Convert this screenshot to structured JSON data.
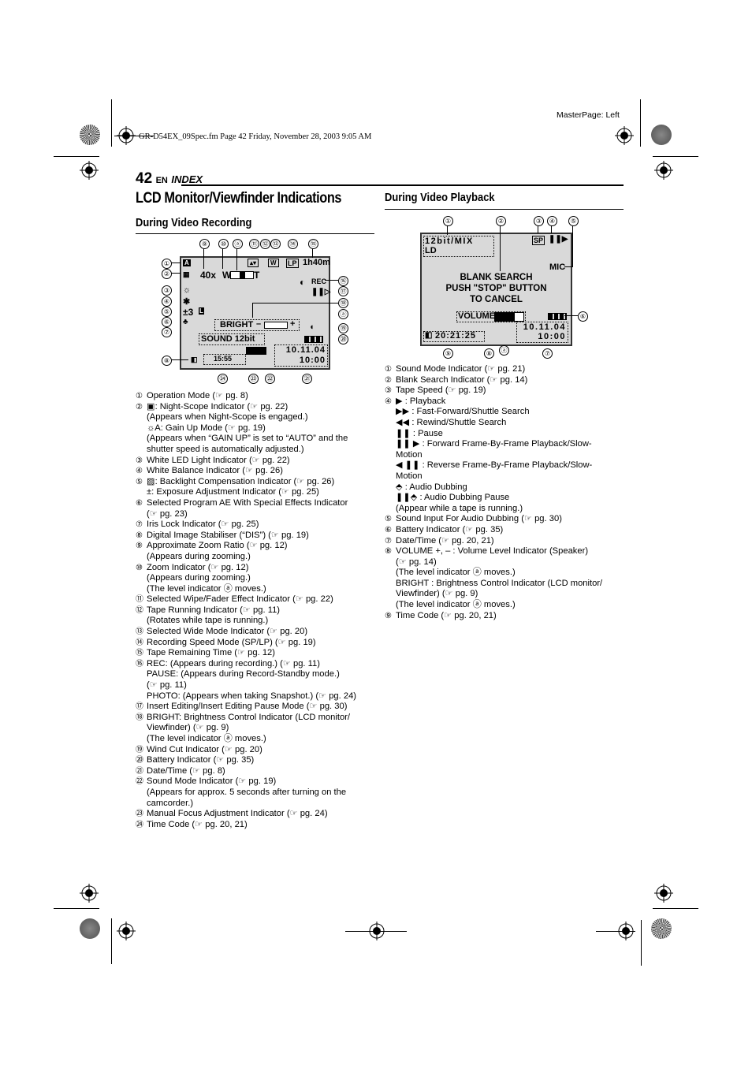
{
  "header": {
    "file_info": "GR-D54EX_09Spec.fm  Page 42  Friday, November 28, 2003  9:05 AM",
    "master_page": "MasterPage: Left",
    "page_number": "42",
    "lang": "EN",
    "section": "INDEX"
  },
  "title": "LCD Monitor/Viewfinder Indications",
  "recording": {
    "heading": "During Video Recording",
    "screen": {
      "zoom_ratio": "40x",
      "zoom_w": "W",
      "zoom_t": "T",
      "tape_speed": "LP",
      "tape_remaining": "1h40m",
      "rec": "REC",
      "exposure": "±3",
      "bright_label": "BRIGHT",
      "bright_minus": "–",
      "bright_plus": "+",
      "sound": "SOUND  12bit",
      "date": "10.11.04",
      "time": "10:00",
      "timecode": "15:55"
    },
    "callouts": [
      "⑨",
      "⑩",
      "ⓐ",
      "⑪",
      "⑫",
      "⑬",
      "⑭",
      "⑮",
      "①",
      "②",
      "③",
      "④",
      "⑤",
      "⑥",
      "⑦",
      "⑧",
      "⑯",
      "⑰",
      "⑱",
      "ⓐ",
      "⑲",
      "⑳",
      "㉔",
      "㉓",
      "㉒",
      "㉑"
    ],
    "items": [
      {
        "num": "①",
        "lines": [
          "Operation Mode (☞ pg. 8)"
        ]
      },
      {
        "num": "②",
        "lines": [
          "▣: Night-Scope Indicator (☞ pg. 22)",
          "(Appears when Night-Scope is engaged.)",
          "☼A: Gain Up Mode (☞ pg. 19)",
          "(Appears when “GAIN UP” is set to “AUTO” and the",
          "shutter speed is automatically adjusted.)"
        ]
      },
      {
        "num": "③",
        "lines": [
          "White LED Light Indicator (☞ pg. 22)"
        ]
      },
      {
        "num": "④",
        "lines": [
          "White Balance Indicator (☞ pg. 26)"
        ]
      },
      {
        "num": "⑤",
        "lines": [
          "▨: Backlight Compensation Indicator (☞ pg. 26)",
          "±: Exposure Adjustment Indicator (☞ pg. 25)"
        ]
      },
      {
        "num": "⑥",
        "lines": [
          "Selected Program AE With Special Effects Indicator",
          "(☞ pg. 23)"
        ]
      },
      {
        "num": "⑦",
        "lines": [
          "Iris Lock Indicator (☞ pg. 25)"
        ]
      },
      {
        "num": "⑧",
        "lines": [
          "Digital Image Stabiliser (“DIS”) (☞ pg. 19)"
        ]
      },
      {
        "num": "⑨",
        "lines": [
          "Approximate Zoom Ratio (☞ pg. 12)",
          "(Appears during zooming.)"
        ]
      },
      {
        "num": "⑩",
        "lines": [
          "Zoom Indicator (☞ pg. 12)",
          "(Appears during zooming.)",
          "(The level indicator ⓐ moves.)"
        ]
      },
      {
        "num": "⑪",
        "lines": [
          "Selected Wipe/Fader Effect Indicator (☞ pg. 22)"
        ]
      },
      {
        "num": "⑫",
        "lines": [
          "Tape Running Indicator (☞ pg. 11)",
          "(Rotates while tape is running.)"
        ]
      },
      {
        "num": "⑬",
        "lines": [
          "Selected Wide Mode Indicator (☞ pg. 20)"
        ]
      },
      {
        "num": "⑭",
        "lines": [
          "Recording Speed Mode (SP/LP) (☞ pg. 19)"
        ]
      },
      {
        "num": "⑮",
        "lines": [
          "Tape Remaining Time (☞ pg. 12)"
        ]
      },
      {
        "num": "⑯",
        "lines": [
          "REC: (Appears during recording.) (☞ pg. 11)",
          "PAUSE: (Appears during Record-Standby mode.)",
          "(☞ pg. 11)",
          "PHOTO: (Appears when taking Snapshot.) (☞ pg. 24)"
        ]
      },
      {
        "num": "⑰",
        "lines": [
          "Insert Editing/Insert Editing Pause Mode (☞ pg. 30)"
        ]
      },
      {
        "num": "⑱",
        "lines": [
          "BRIGHT: Brightness Control Indicator (LCD monitor/",
          "Viewfinder) (☞ pg. 9)",
          "(The level indicator ⓐ moves.)"
        ]
      },
      {
        "num": "⑲",
        "lines": [
          "Wind Cut Indicator (☞ pg. 20)"
        ]
      },
      {
        "num": "⑳",
        "lines": [
          "Battery Indicator (☞ pg. 35)"
        ]
      },
      {
        "num": "㉑",
        "lines": [
          "Date/Time (☞ pg. 8)"
        ]
      },
      {
        "num": "㉒",
        "lines": [
          "Sound Mode Indicator (☞ pg. 19)",
          "(Appears for approx. 5 seconds after turning on the",
          "camcorder.)"
        ]
      },
      {
        "num": "㉓",
        "lines": [
          "Manual Focus Adjustment Indicator (☞ pg. 24)"
        ]
      },
      {
        "num": "㉔",
        "lines": [
          "Time Code (☞ pg. 20, 21)"
        ]
      }
    ]
  },
  "playback": {
    "heading": "During Video Playback",
    "screen": {
      "sound_mode": "12bit/MIX",
      "ld": "LD",
      "tape_speed": "SP",
      "play_state": "❚❚▶",
      "mic": "MIC",
      "message": [
        "BLANK SEARCH",
        "PUSH \"STOP\" BUTTON",
        "TO CANCEL"
      ],
      "volume_label": "VOLUME",
      "volume_level": 0.7,
      "date": "10.11.04",
      "time": "10:00",
      "timecode": "20:21:25"
    },
    "callouts": [
      "①",
      "②",
      "③",
      "④",
      "⑤",
      "⑥",
      "⑨",
      "⑧",
      "ⓐ",
      "⑦"
    ],
    "items": [
      {
        "num": "①",
        "lines": [
          "Sound Mode Indicator (☞ pg. 21)"
        ]
      },
      {
        "num": "②",
        "lines": [
          "Blank Search Indicator (☞ pg. 14)"
        ]
      },
      {
        "num": "③",
        "lines": [
          "Tape Speed (☞ pg. 19)"
        ]
      },
      {
        "num": "④",
        "lines": [
          "▶ : Playback",
          "▶▶ : Fast-Forward/Shuttle Search",
          "◀◀ : Rewind/Shuttle Search",
          "❚❚ : Pause",
          "❚❚ ▶ : Forward Frame-By-Frame Playback/Slow-",
          "Motion",
          "◀ ❚❚ : Reverse Frame-By-Frame Playback/Slow-",
          "Motion",
          "⬘ : Audio Dubbing",
          "❚❚⬘ : Audio Dubbing Pause",
          "(Appear while a tape is running.)"
        ]
      },
      {
        "num": "⑤",
        "lines": [
          "Sound Input For Audio Dubbing (☞ pg. 30)"
        ]
      },
      {
        "num": "⑥",
        "lines": [
          "Battery Indicator (☞ pg. 35)"
        ]
      },
      {
        "num": "⑦",
        "lines": [
          "Date/Time (☞ pg. 20, 21)"
        ]
      },
      {
        "num": "⑧",
        "lines": [
          "VOLUME +, – : Volume Level Indicator (Speaker)",
          "(☞ pg. 14)",
          "(The level indicator ⓐ moves.)",
          "BRIGHT : Brightness Control Indicator (LCD monitor/",
          "Viewfinder) (☞ pg. 9)",
          "(The level indicator ⓐ moves.)"
        ]
      },
      {
        "num": "⑨",
        "lines": [
          "Time Code (☞ pg. 20, 21)"
        ]
      }
    ]
  }
}
